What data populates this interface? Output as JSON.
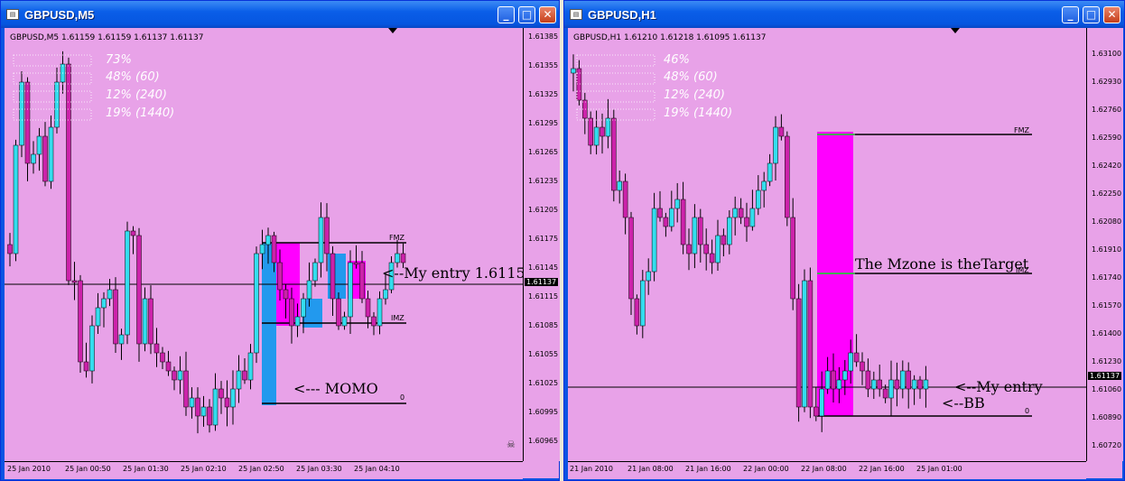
{
  "left": {
    "title": "GBPUSD,M5",
    "header": "GBPUSD,M5  1.61159 1.61159 1.61137 1.61137",
    "percents": [
      "73%",
      "48%  (60)",
      "12%  (240)",
      "19%  (1440)"
    ],
    "price_labels": [
      "1.61385",
      "1.61355",
      "1.61325",
      "1.61295",
      "1.61265",
      "1.61235",
      "1.61205",
      "1.61175",
      "1.61145",
      "1.61115",
      "1.61085",
      "1.61055",
      "1.61025",
      "1.60995",
      "1.60965"
    ],
    "current_price": "1.61137",
    "time_labels": [
      "25 Jan 2010",
      "25 Jan 00:50",
      "25 Jan 01:30",
      "25 Jan 02:10",
      "25 Jan 02:50",
      "25 Jan 03:30",
      "25 Jan 04:10"
    ],
    "levels": {
      "fmz": "FMZ",
      "imz": "IMZ",
      "zero": "0"
    },
    "notes": {
      "entry": "<--My entry 1.6115",
      "momo": "<--- MOMO"
    }
  },
  "right": {
    "title": "GBPUSD,H1",
    "header": "GBPUSD,H1  1.61210 1.61218 1.61095 1.61137",
    "percents": [
      "46%",
      "48%  (60)",
      "12%  (240)",
      "19%  (1440)"
    ],
    "price_labels": [
      "1.63100",
      "1.62930",
      "1.62760",
      "1.62590",
      "1.62420",
      "1.62250",
      "1.62080",
      "1.61910",
      "1.61740",
      "1.61570",
      "1.61400",
      "1.61230",
      "1.61060",
      "1.60890",
      "1.60720"
    ],
    "current_price": "1.61137",
    "time_labels": [
      "21 Jan 2010",
      "21 Jan 08:00",
      "21 Jan 16:00",
      "22 Jan 00:00",
      "22 Jan 08:00",
      "22 Jan 16:00",
      "25 Jan 01:00"
    ],
    "levels": {
      "fmz": "FMZ",
      "imz": "IMZ",
      "zero": "0"
    },
    "notes": {
      "target": "The Mzone is theTarget",
      "entry": "<--My entry",
      "bb": "<--BB"
    }
  },
  "colors": {
    "background": "#e8a2e8",
    "bull": "#33ddee",
    "bear": "#cc22aa",
    "zone": "#ff00ff",
    "momo": "#2299ee",
    "titlebar": "#0a5ee8"
  }
}
